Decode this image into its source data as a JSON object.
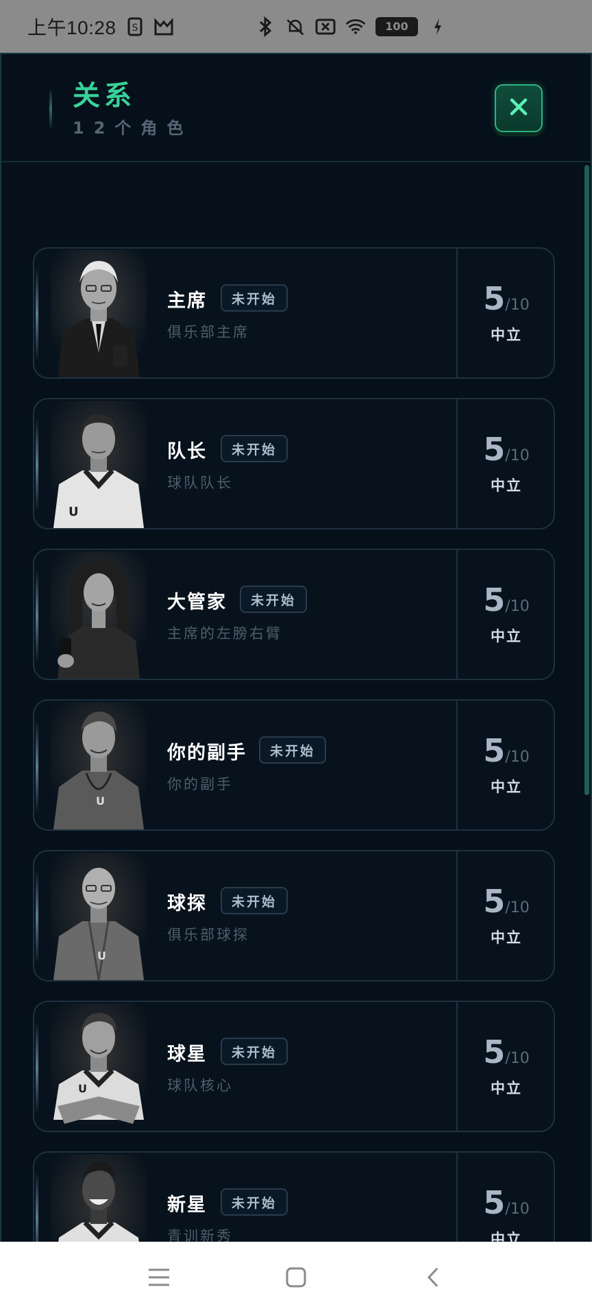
{
  "status_bar": {
    "time": "上午10:28",
    "battery": "100",
    "icons": [
      "sim-icon",
      "cat-icon",
      "bluetooth-icon",
      "mute-icon",
      "no-sim-icon",
      "wifi-icon",
      "battery-icon",
      "charging-icon"
    ]
  },
  "header": {
    "title": "关系",
    "subtitle": "12个角色",
    "close_icon": "close-icon"
  },
  "characters": [
    {
      "name": "主席",
      "status": "未开始",
      "role": "俱乐部主席",
      "score": "5",
      "max": "/10",
      "mood": "中立"
    },
    {
      "name": "队长",
      "status": "未开始",
      "role": "球队队长",
      "score": "5",
      "max": "/10",
      "mood": "中立"
    },
    {
      "name": "大管家",
      "status": "未开始",
      "role": "主席的左膀右臂",
      "score": "5",
      "max": "/10",
      "mood": "中立"
    },
    {
      "name": "你的副手",
      "status": "未开始",
      "role": "你的副手",
      "score": "5",
      "max": "/10",
      "mood": "中立"
    },
    {
      "name": "球探",
      "status": "未开始",
      "role": "俱乐部球探",
      "score": "5",
      "max": "/10",
      "mood": "中立"
    },
    {
      "name": "球星",
      "status": "未开始",
      "role": "球队核心",
      "score": "5",
      "max": "/10",
      "mood": "中立"
    },
    {
      "name": "新星",
      "status": "未开始",
      "role": "青训新秀",
      "score": "5",
      "max": "/10",
      "mood": "中立"
    }
  ],
  "nav": [
    "menu-icon",
    "home-icon",
    "back-icon"
  ],
  "colors": {
    "accent": "#39d29a",
    "background": "#06101a",
    "card_border": "#1f3140"
  }
}
